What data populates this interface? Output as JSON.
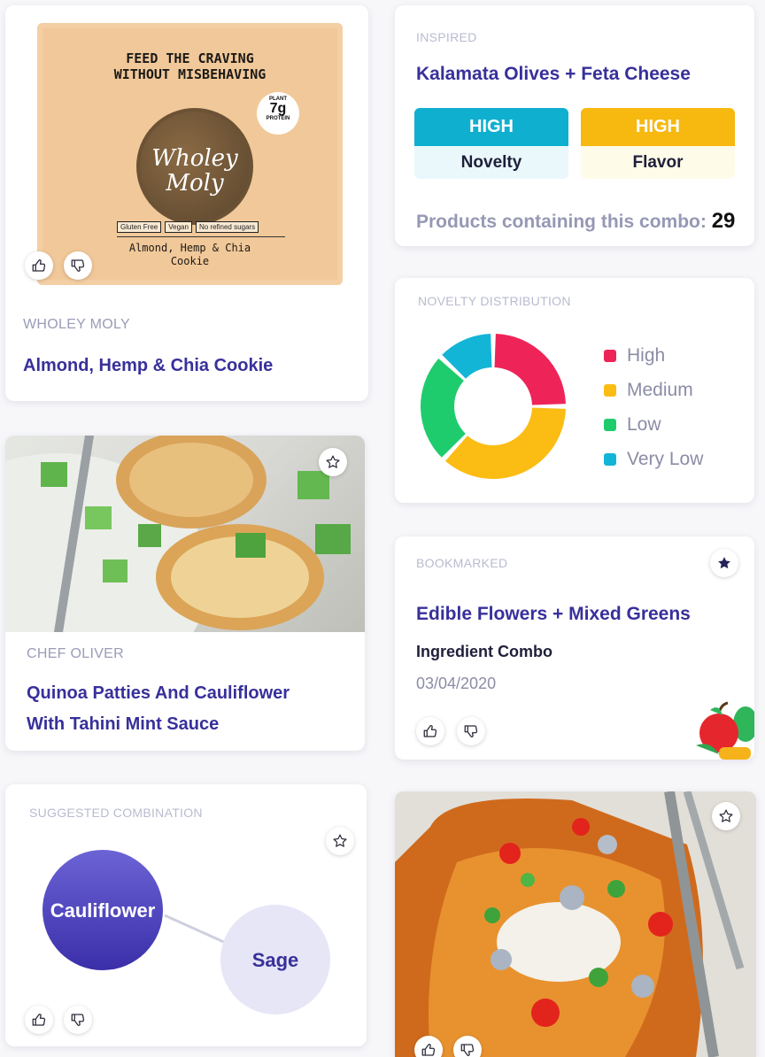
{
  "product_card": {
    "brand": "WHOLEY MOLY",
    "name": "Almond, Hemp & Chia Cookie",
    "package": {
      "headline_1": "FEED THE CRAVING",
      "headline_2": "WITHOUT MISBEHAVING",
      "logo_1": "Wholey",
      "logo_2": "Moly",
      "protein_top": "PLANT",
      "protein_value": "7g",
      "protein_bottom": "PROTEIN",
      "tag_1": "Gluten Free",
      "tag_2": "Vegan",
      "tag_3": "No refined sugars",
      "flavor_1": "Almond, Hemp & Chia",
      "flavor_2": "Cookie"
    },
    "icons": [
      "thumbs-up-icon",
      "thumbs-down-icon"
    ]
  },
  "inspired_card": {
    "caption": "INSPIRED",
    "title": "Kalamata Olives + Feta Cheese",
    "metrics": [
      {
        "level": "HIGH",
        "label": "Novelty",
        "color": "#0fb0cf"
      },
      {
        "level": "HIGH",
        "label": "Flavor",
        "color": "#f7b80f"
      }
    ],
    "count_label": "Products containing this combo:",
    "count_value": "29"
  },
  "novelty_card": {
    "caption": "NOVELTY DISTRIBUTION",
    "chart_data": {
      "type": "pie",
      "donut": true,
      "categories": [
        "High",
        "Medium",
        "Low",
        "Very Low"
      ],
      "values": [
        25,
        37,
        25,
        13
      ],
      "colors": [
        "#ee2459",
        "#fbbc14",
        "#1fcc6d",
        "#13b5d6"
      ],
      "legend_position": "right"
    }
  },
  "recipe_card": {
    "author": "CHEF OLIVER",
    "title_1": "Quinoa Patties And Cauliflower",
    "title_2": "With Tahini Mint Sauce",
    "icons": [
      "star-icon"
    ]
  },
  "bookmark_card": {
    "caption": "BOOKMARKED",
    "title": "Edible Flowers + Mixed Greens",
    "type": "Ingredient Combo",
    "date": "03/04/2020",
    "icons": [
      "star-filled-icon",
      "thumbs-up-icon",
      "thumbs-down-icon",
      "fruit-veg-icon"
    ]
  },
  "combination_card": {
    "caption": "SUGGESTED COMBINATION",
    "node_1": "Cauliflower",
    "node_2": "Sage",
    "icons": [
      "star-icon",
      "thumbs-up-icon",
      "thumbs-down-icon"
    ]
  },
  "photo_card": {
    "icons": [
      "star-icon",
      "thumbs-up-icon",
      "thumbs-down-icon"
    ]
  }
}
